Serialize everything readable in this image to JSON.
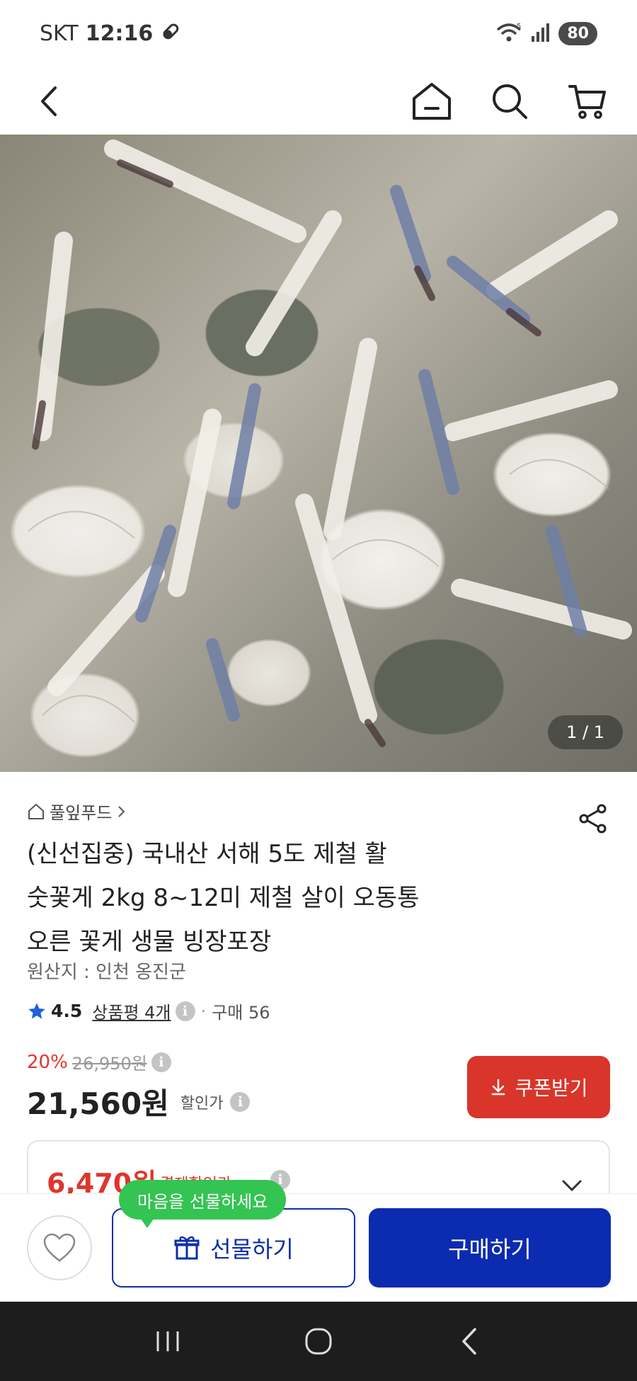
{
  "status_bar": {
    "carrier": "SKT",
    "time": "12:16",
    "battery": "80",
    "network": "5"
  },
  "top_nav": {
    "back_icon": "chevron-left-icon",
    "home_icon": "home-icon",
    "search_icon": "search-icon",
    "cart_icon": "cart-icon"
  },
  "gallery": {
    "indicator": "1 / 1"
  },
  "product": {
    "brand": "풀잎푸드",
    "title_lines": [
      "(신선집중) 국내산 서해 5도 제철 활",
      "숫꽃게 2kg 8~12미 제철 살이 오동통",
      "오른 꽃게 생물 빙장포장"
    ],
    "origin": "원산지 : 인천 옹진군",
    "rating": "4.5",
    "review_label": "상품평 4개",
    "purchase_label": "구매 56"
  },
  "price": {
    "discount_pct": "20%",
    "original": "26,950원",
    "final": "21,560원",
    "final_label": "할인가",
    "coupon_button": "쿠폰받기",
    "payment_price": "6,470원",
    "payment_label": "결제할인가"
  },
  "action_bar": {
    "gift_tooltip": "마음을 선물하세요",
    "gift_button": "선물하기",
    "buy_button": "구매하기"
  },
  "colors": {
    "accent_red": "#d9352a",
    "accent_blue": "#0b2bb0",
    "tooltip_green": "#34c452"
  }
}
